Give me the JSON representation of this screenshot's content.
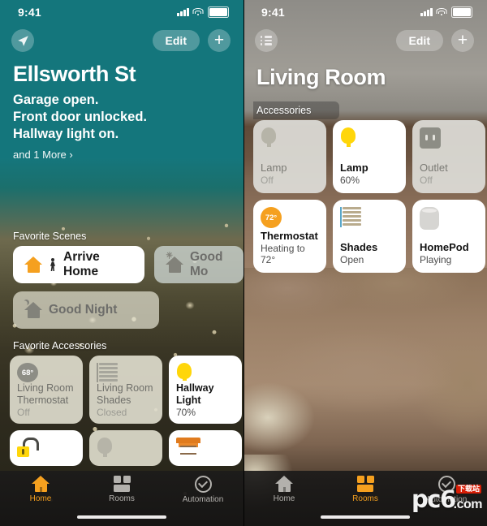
{
  "left_phone": {
    "status_bar": {
      "time": "9:41",
      "cellular": "signal-bars",
      "wifi": "wifi-icon",
      "battery": "battery-icon"
    },
    "nav": {
      "location_icon": "location-arrow-icon",
      "edit_label": "Edit",
      "add_label": "+"
    },
    "home_title": "Ellsworth St",
    "status_lines": [
      "Garage open.",
      "Front door unlocked.",
      "Hallway light on."
    ],
    "more_link": "and 1 More ›",
    "scenes_section_label": "Favorite Scenes",
    "scenes": [
      {
        "name": "Arrive Home",
        "state": "on",
        "icon": "house-walker-icon"
      },
      {
        "name": "Good Mo",
        "state": "off",
        "icon": "house-sun-icon"
      },
      {
        "name": "Good Night",
        "state": "off",
        "icon": "house-moon-icon"
      }
    ],
    "accessories_section_label": "Favorite Accessories",
    "accessories": [
      {
        "title": "Living Room Thermostat",
        "subtitle": "Off",
        "state": "off",
        "icon": "thermostat-dial-icon",
        "value": "68°"
      },
      {
        "title": "Living Room Shades",
        "subtitle": "Closed",
        "state": "off",
        "icon": "blinds-icon"
      },
      {
        "title": "Hallway Light",
        "subtitle": "70%",
        "state": "on",
        "icon": "lightbulb-icon"
      }
    ],
    "accessories_partial": [
      {
        "icon": "unlocked-padlock-icon",
        "state": "on"
      },
      {
        "icon": "lightbulb-off-icon",
        "state": "off"
      },
      {
        "icon": "garage-door-icon",
        "state": "on"
      }
    ],
    "tabs": [
      {
        "label": "Home",
        "icon": "home-icon",
        "active": true
      },
      {
        "label": "Rooms",
        "icon": "rooms-icon",
        "active": false
      },
      {
        "label": "Automation",
        "icon": "automation-clock-icon",
        "active": false
      }
    ]
  },
  "right_phone": {
    "status_bar": {
      "time": "9:41",
      "cellular": "signal-bars",
      "wifi": "wifi-icon",
      "battery": "battery-icon"
    },
    "nav": {
      "list_icon": "room-list-icon",
      "edit_label": "Edit",
      "add_label": "+"
    },
    "room_title": "Living Room",
    "accessories_section_label": "Accessories",
    "accessories": [
      {
        "title": "Lamp",
        "subtitle": "Off",
        "state": "off",
        "icon": "lightbulb-off-icon"
      },
      {
        "title": "Lamp",
        "subtitle": "60%",
        "state": "on",
        "icon": "lightbulb-on-icon"
      },
      {
        "title": "Outlet",
        "subtitle": "Off",
        "state": "off",
        "icon": "outlet-icon"
      },
      {
        "title": "Thermostat",
        "subtitle": "Heating to 72°",
        "state": "on",
        "icon": "thermostat-dial-icon",
        "value": "72°"
      },
      {
        "title": "Shades",
        "subtitle": "Open",
        "state": "on",
        "icon": "blinds-open-icon"
      },
      {
        "title": "HomePod",
        "subtitle": "Playing",
        "state": "on",
        "icon": "homepod-icon"
      }
    ],
    "tabs": [
      {
        "label": "Home",
        "icon": "home-icon",
        "active": false
      },
      {
        "label": "Rooms",
        "icon": "rooms-icon",
        "active": true
      },
      {
        "label": "Automation",
        "icon": "automation-clock-icon",
        "active": false
      }
    ]
  },
  "watermark": {
    "name": "pc6",
    "suffix": ".com",
    "badge": "下载站"
  },
  "colors": {
    "accent": "#f5a01f",
    "home_teal": "#14767c",
    "bulb_yellow": "#ffd60a",
    "badge_red": "#d81e06"
  }
}
